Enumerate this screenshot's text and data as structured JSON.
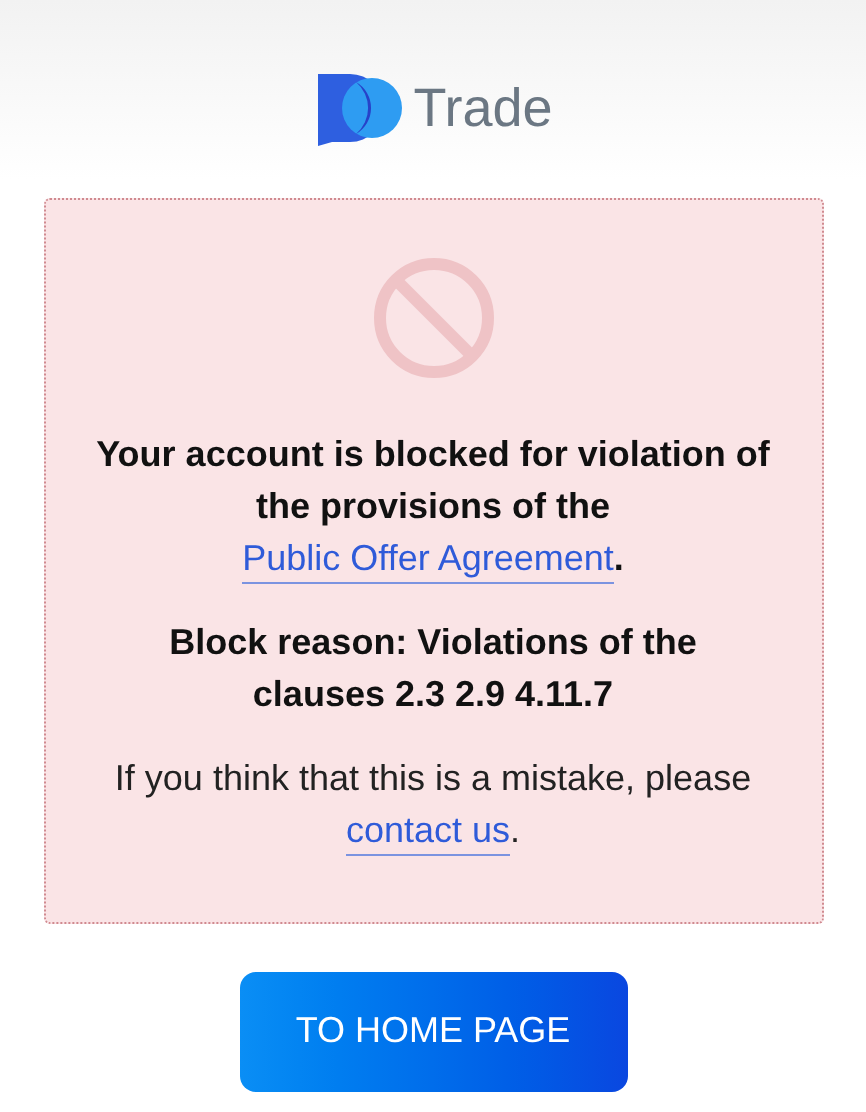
{
  "logo": {
    "text": "Trade"
  },
  "notice": {
    "blocked_message": {
      "before": "Your account is blocked for violation of the provisions of the ",
      "link": "Public Offer Agreement",
      "after": "."
    },
    "reason": "Block reason: Violations of the clauses 2.3 2.9 4.11.7",
    "help": {
      "before": "If you think that this is a mistake, please ",
      "link": "contact us",
      "after": "."
    }
  },
  "button": {
    "label": "TO HOME PAGE"
  }
}
